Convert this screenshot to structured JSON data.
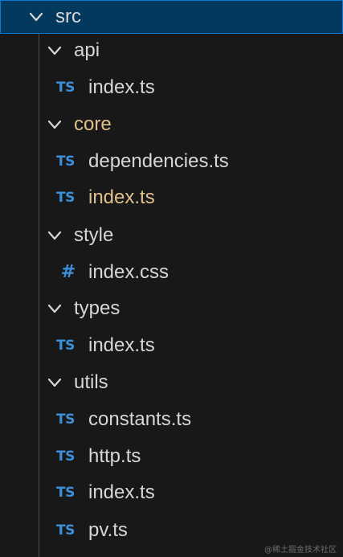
{
  "tree": {
    "root": {
      "label": "src"
    },
    "api": {
      "label": "api",
      "files": [
        {
          "icon": "TS",
          "label": "index.ts"
        }
      ]
    },
    "core": {
      "label": "core",
      "files": [
        {
          "icon": "TS",
          "label": "dependencies.ts"
        },
        {
          "icon": "TS",
          "label": "index.ts"
        }
      ]
    },
    "style": {
      "label": "style",
      "files": [
        {
          "icon": "#",
          "label": "index.css"
        }
      ]
    },
    "types": {
      "label": "types",
      "files": [
        {
          "icon": "TS",
          "label": "index.ts"
        }
      ]
    },
    "utils": {
      "label": "utils",
      "files": [
        {
          "icon": "TS",
          "label": "constants.ts"
        },
        {
          "icon": "TS",
          "label": "http.ts"
        },
        {
          "icon": "TS",
          "label": "index.ts"
        },
        {
          "icon": "TS",
          "label": "pv.ts"
        }
      ]
    }
  },
  "watermark": "@稀土掘金技术社区",
  "colors": {
    "background": "#181818",
    "selected_bg": "#04395e",
    "selected_border": "#0a78d6",
    "text": "#d7d7d7",
    "modified_text": "#e2c08d",
    "ts_icon": "#3c8fd9",
    "indent_guide": "#4e4e4e"
  },
  "icons": {
    "folder_expanded": "chevron-down-icon",
    "typescript_file": "typescript-file-icon",
    "css_file": "css-file-icon"
  }
}
